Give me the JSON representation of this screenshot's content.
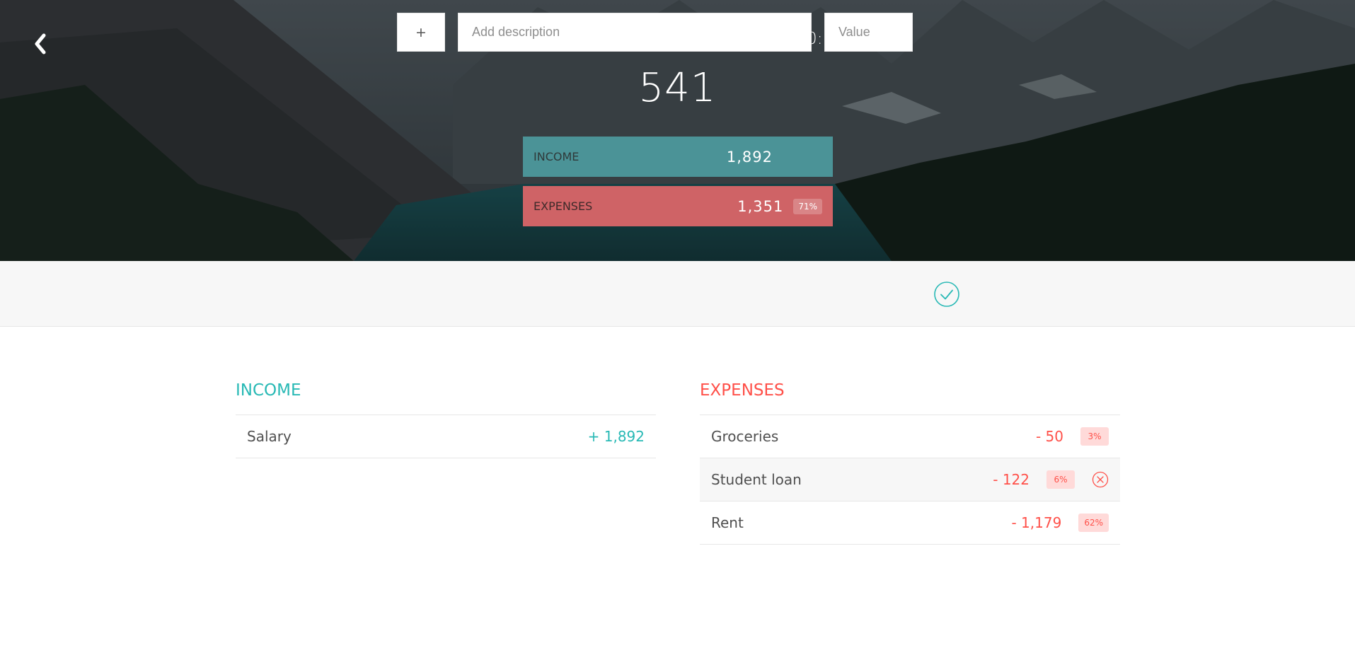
{
  "header": {
    "back_icon": "chevron-left-icon",
    "title": "Available Budget in February 2020:",
    "budget": "541",
    "income": {
      "label": "INCOME",
      "value": "1,892",
      "color": "#4b9397"
    },
    "expenses": {
      "label": "EXPENSES",
      "value": "1,351",
      "percentage": "71%",
      "color": "#cf6366"
    }
  },
  "add_bar": {
    "type_value": "+",
    "description_placeholder": "Add description",
    "value_placeholder": "Value",
    "submit_icon": "check-circle-icon",
    "accent_color": "#28b9b5"
  },
  "income_list": {
    "title": "INCOME",
    "color": "#28b9b5",
    "items": [
      {
        "description": "Salary",
        "amount": "+ 1,892"
      }
    ]
  },
  "expenses_list": {
    "title": "EXPENSES",
    "color": "#ff5049",
    "items": [
      {
        "description": "Groceries",
        "amount": "- 50",
        "percentage": "3%"
      },
      {
        "description": "Student loan",
        "amount": "- 122",
        "percentage": "6%",
        "delete_icon": "close-circle-icon"
      },
      {
        "description": "Rent",
        "amount": "- 1,179",
        "percentage": "62%"
      }
    ]
  }
}
